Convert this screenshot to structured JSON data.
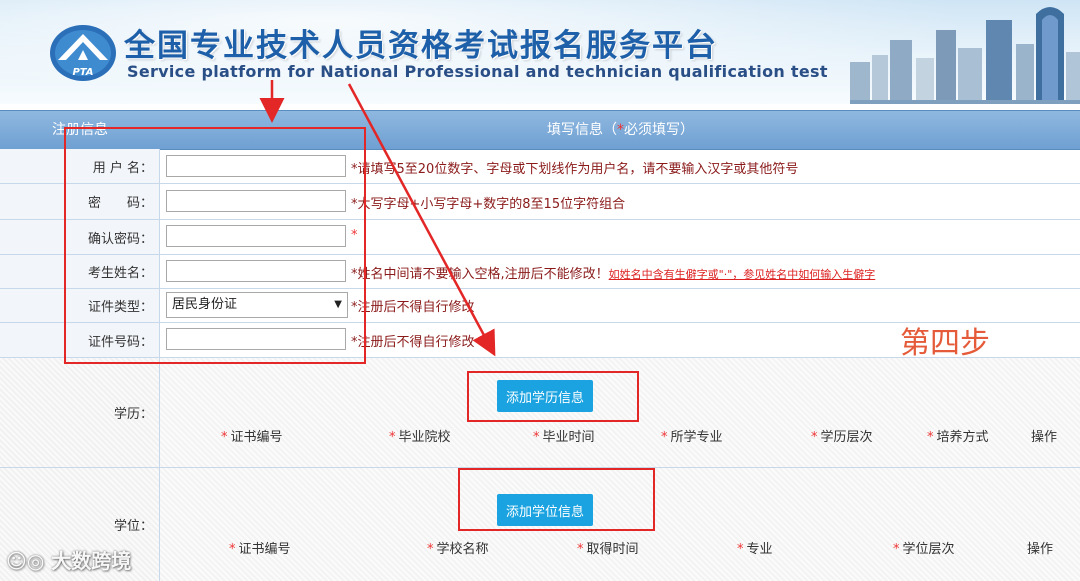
{
  "header": {
    "title_cn": "全国专业技术人员资格考试报名服务平台",
    "title_en": "Service platform for National Professional and technician  qualification test",
    "logo_text": "PTA"
  },
  "table_head": {
    "left": "注册信息",
    "right_prefix": "填写信息（",
    "right_req": "*",
    "right_suffix": "必须填写）"
  },
  "fields": {
    "username": {
      "label": "用 户 名：",
      "hint": "*请填写5至20位数字、字母或下划线作为用户名，请不要输入汉字或其他符号"
    },
    "password": {
      "label": "密　　码：",
      "hint": "*大写字母+小写字母+数字的8至15位字符组合"
    },
    "confirm": {
      "label": "确认密码：",
      "hint": "*"
    },
    "name": {
      "label": "考生姓名：",
      "hint": "*姓名中间请不要输入空格,注册后不能修改！",
      "link": "如姓名中含有生僻字或\"·\"，参见姓名中如何输入生僻字"
    },
    "idtype": {
      "label": "证件类型：",
      "selected": "居民身份证",
      "hint": "*注册后不得自行修改"
    },
    "idnum": {
      "label": "证件号码：",
      "hint": "*注册后不得自行修改"
    }
  },
  "education": {
    "label": "学历：",
    "button": "添加学历信息",
    "columns": [
      "证书编号",
      "毕业院校",
      "毕业时间",
      "所学专业",
      "学历层次",
      "培养方式"
    ],
    "action": "操作"
  },
  "degree": {
    "label": "学位：",
    "button": "添加学位信息",
    "columns": [
      "证书编号",
      "学校名称",
      "取得时间",
      "专业",
      "学位层次"
    ],
    "action": "操作"
  },
  "annotation": {
    "step": "第四步"
  },
  "watermark": "大数跨境",
  "colors": {
    "accent": "#1aa3e0",
    "annotation_red": "#e32626",
    "header_blue": "#6fa0d2"
  }
}
